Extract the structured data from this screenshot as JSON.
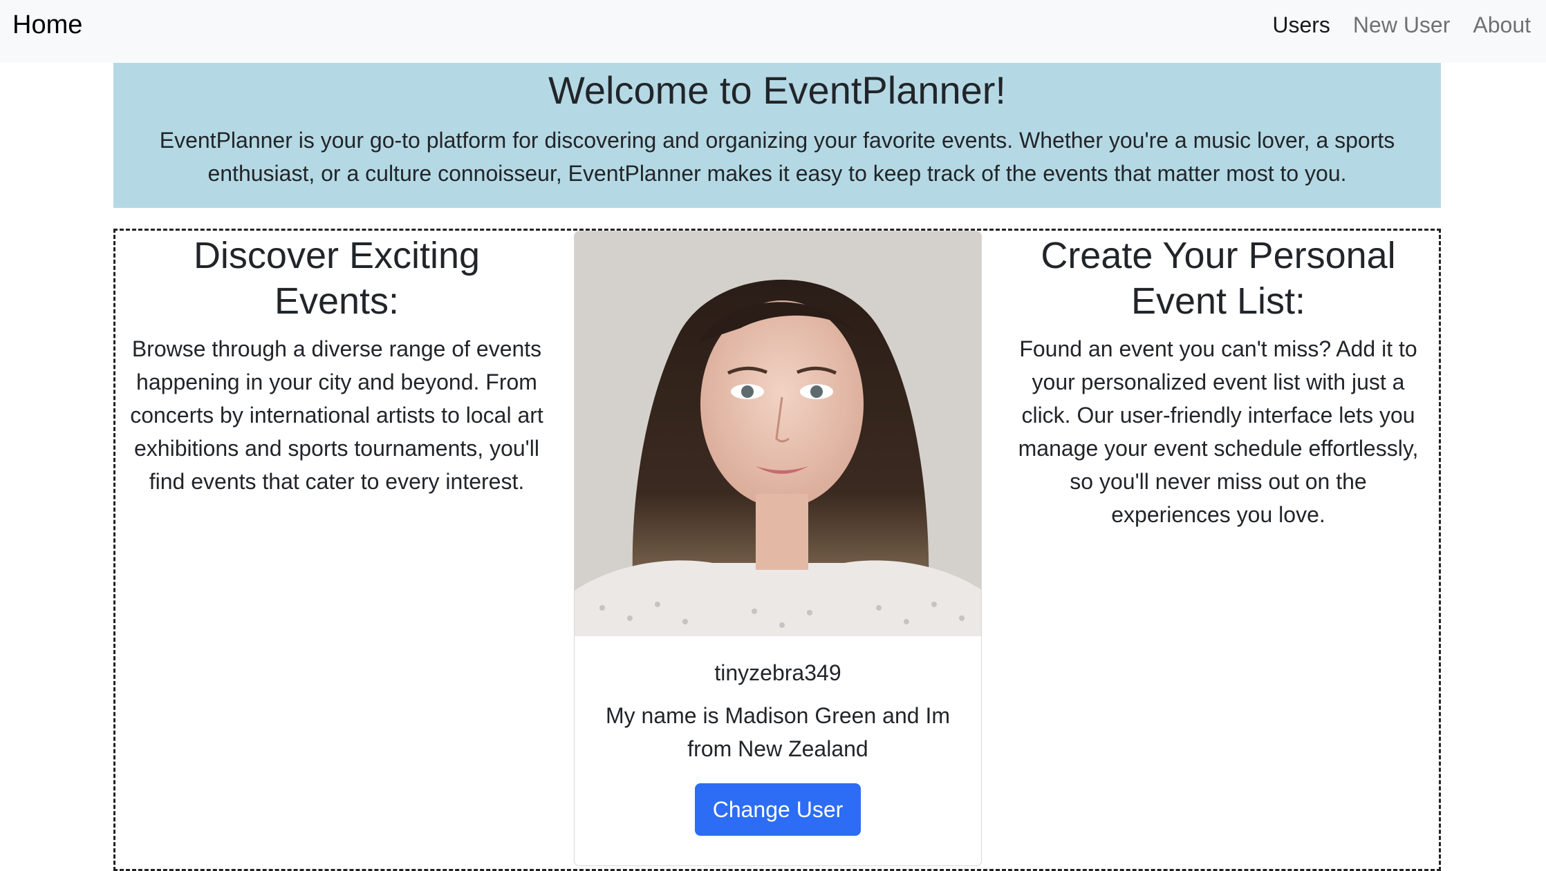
{
  "navbar": {
    "brand": "Home",
    "links": [
      {
        "label": "Users",
        "active": true
      },
      {
        "label": "New User",
        "active": false
      },
      {
        "label": "About",
        "active": false
      }
    ]
  },
  "banner": {
    "title": "Welcome to EventPlanner!",
    "text": "EventPlanner is your go-to platform for discovering and organizing your favorite events. Whether you're a music lover, a sports enthusiast, or a culture connoisseur, EventPlanner makes it easy to keep track of the events that matter most to you."
  },
  "discover": {
    "heading": "Discover Exciting Events:",
    "text": "Browse through a diverse range of events happening in your city and beyond. From concerts by international artists to local art exhibitions and sports tournaments, you'll find events that cater to every interest."
  },
  "user_card": {
    "photo_icon": "user-photo",
    "username": "tinyzebra349",
    "bio": "My name is Madison Green and Im from New Zealand",
    "button_label": "Change User",
    "button_color": "#2d6cf4"
  },
  "create": {
    "heading": "Create Your Personal Event List:",
    "text": "Found an event you can't miss? Add it to your personalized event list with just a click. Our user-friendly interface lets you manage your event schedule effortlessly, so you'll never miss out on the experiences you love."
  },
  "colors": {
    "banner_bg": "#b5d9e4",
    "navbar_bg": "#f8f9fa"
  }
}
